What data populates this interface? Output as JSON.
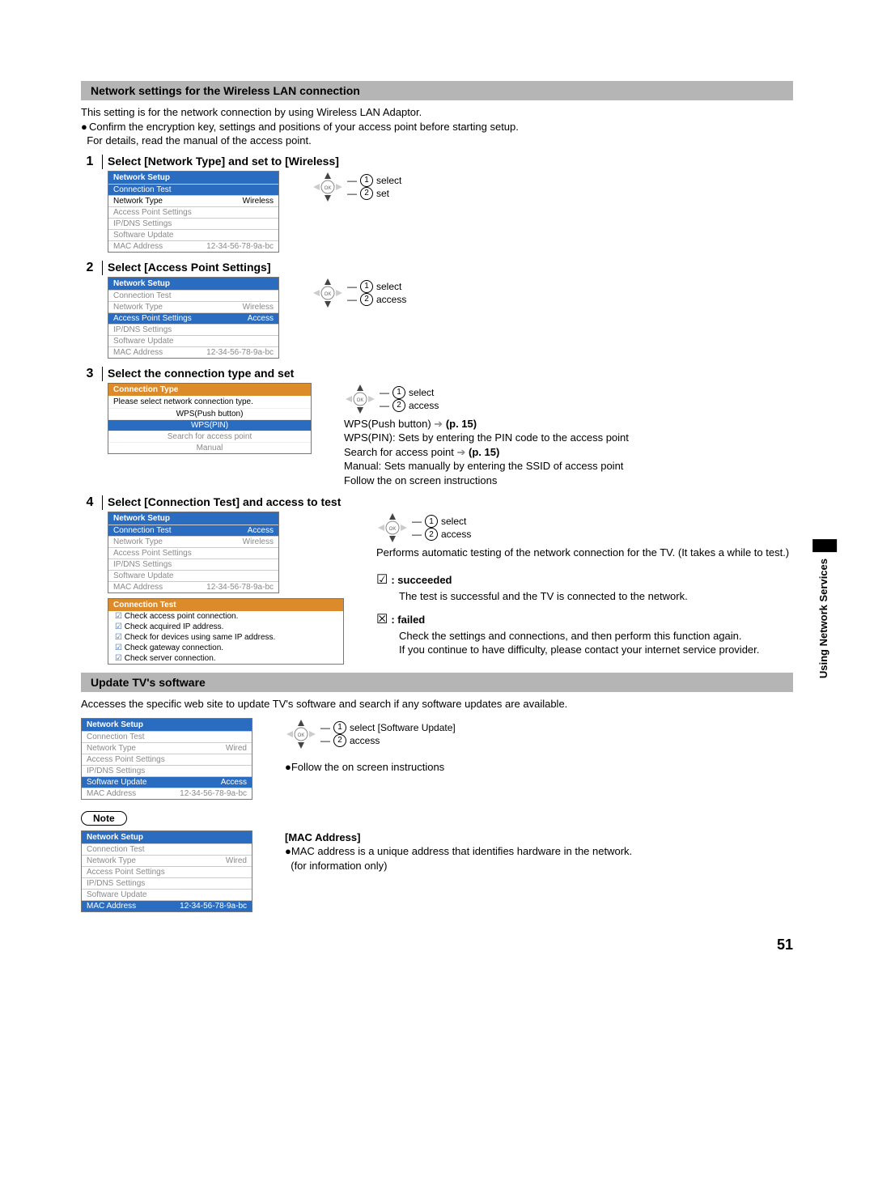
{
  "section1": {
    "title": "Network settings for the Wireless LAN connection",
    "intro_line1": "This setting is for the network connection by using Wireless LAN Adaptor.",
    "intro_line2": "Confirm the encryption key, settings and positions of your access point before starting setup.",
    "intro_line3": "For details, read the manual of the access point."
  },
  "steps": {
    "s1": {
      "num": "1",
      "title": "Select [Network Type] and set to [Wireless]",
      "nav1": "select",
      "nav2": "set"
    },
    "s2": {
      "num": "2",
      "title": "Select [Access Point Settings]",
      "nav1": "select",
      "nav2": "access"
    },
    "s3": {
      "num": "3",
      "title": "Select the connection type and set",
      "nav1": "select",
      "nav2": "access",
      "line_wps_btn_a": "WPS(Push button)",
      "line_wps_btn_b": "(p. 15)",
      "line_wps_pin": "WPS(PIN): Sets by entering the PIN code to the access point",
      "line_search_a": "Search for access point",
      "line_search_b": "(p. 15)",
      "line_manual": "Manual: Sets manually by entering the SSID of access point",
      "line_follow": "Follow the on screen instructions"
    },
    "s4": {
      "num": "4",
      "title": "Select [Connection Test] and access to test",
      "nav1": "select",
      "nav2": "access",
      "explain": "Performs automatic testing of the network connection for the TV. (It takes a while to test.)",
      "succeeded_label": ": succeeded",
      "succeeded_text": "The test is successful and the TV is connected to the network.",
      "failed_label": ": failed",
      "failed_text1": "Check the settings and connections, and then perform this function again.",
      "failed_text2": "If you continue to have difficulty, please contact your internet service provider."
    }
  },
  "menu": {
    "title": "Network Setup",
    "connection_test": "Connection Test",
    "network_type": "Network Type",
    "access_point_settings": "Access Point Settings",
    "ipdns_settings": "IP/DNS Settings",
    "software_update": "Software Update",
    "mac_address": "MAC Address",
    "val_wireless": "Wireless",
    "val_wired": "Wired",
    "val_access": "Access",
    "val_mac": "12-34-56-78-9a-bc"
  },
  "conn": {
    "title": "Connection Type",
    "prompt": "Please select network connection type.",
    "wps_push": "WPS(Push button)",
    "wps_pin": "WPS(PIN)",
    "search_ap": "Search for access point",
    "manual": "Manual"
  },
  "test": {
    "title": "Connection Test",
    "t1": "Check access point connection.",
    "t2": "Check acquired IP address.",
    "t3": "Check for devices using same IP address.",
    "t4": "Check gateway connection.",
    "t5": "Check server connection."
  },
  "section2": {
    "title": "Update TV's software",
    "intro": "Accesses the specific web site to update TV's software and search if any software updates are available.",
    "nav1": "select [Software Update]",
    "nav2": "access",
    "follow": "Follow the on screen instructions"
  },
  "note": {
    "label": "Note",
    "mac_heading": "[MAC Address]",
    "mac_line1": "MAC address is a unique address that identifies hardware in the network.",
    "mac_line2": "(for information only)"
  },
  "side_tab": "Using Network Services",
  "page_number": "51"
}
